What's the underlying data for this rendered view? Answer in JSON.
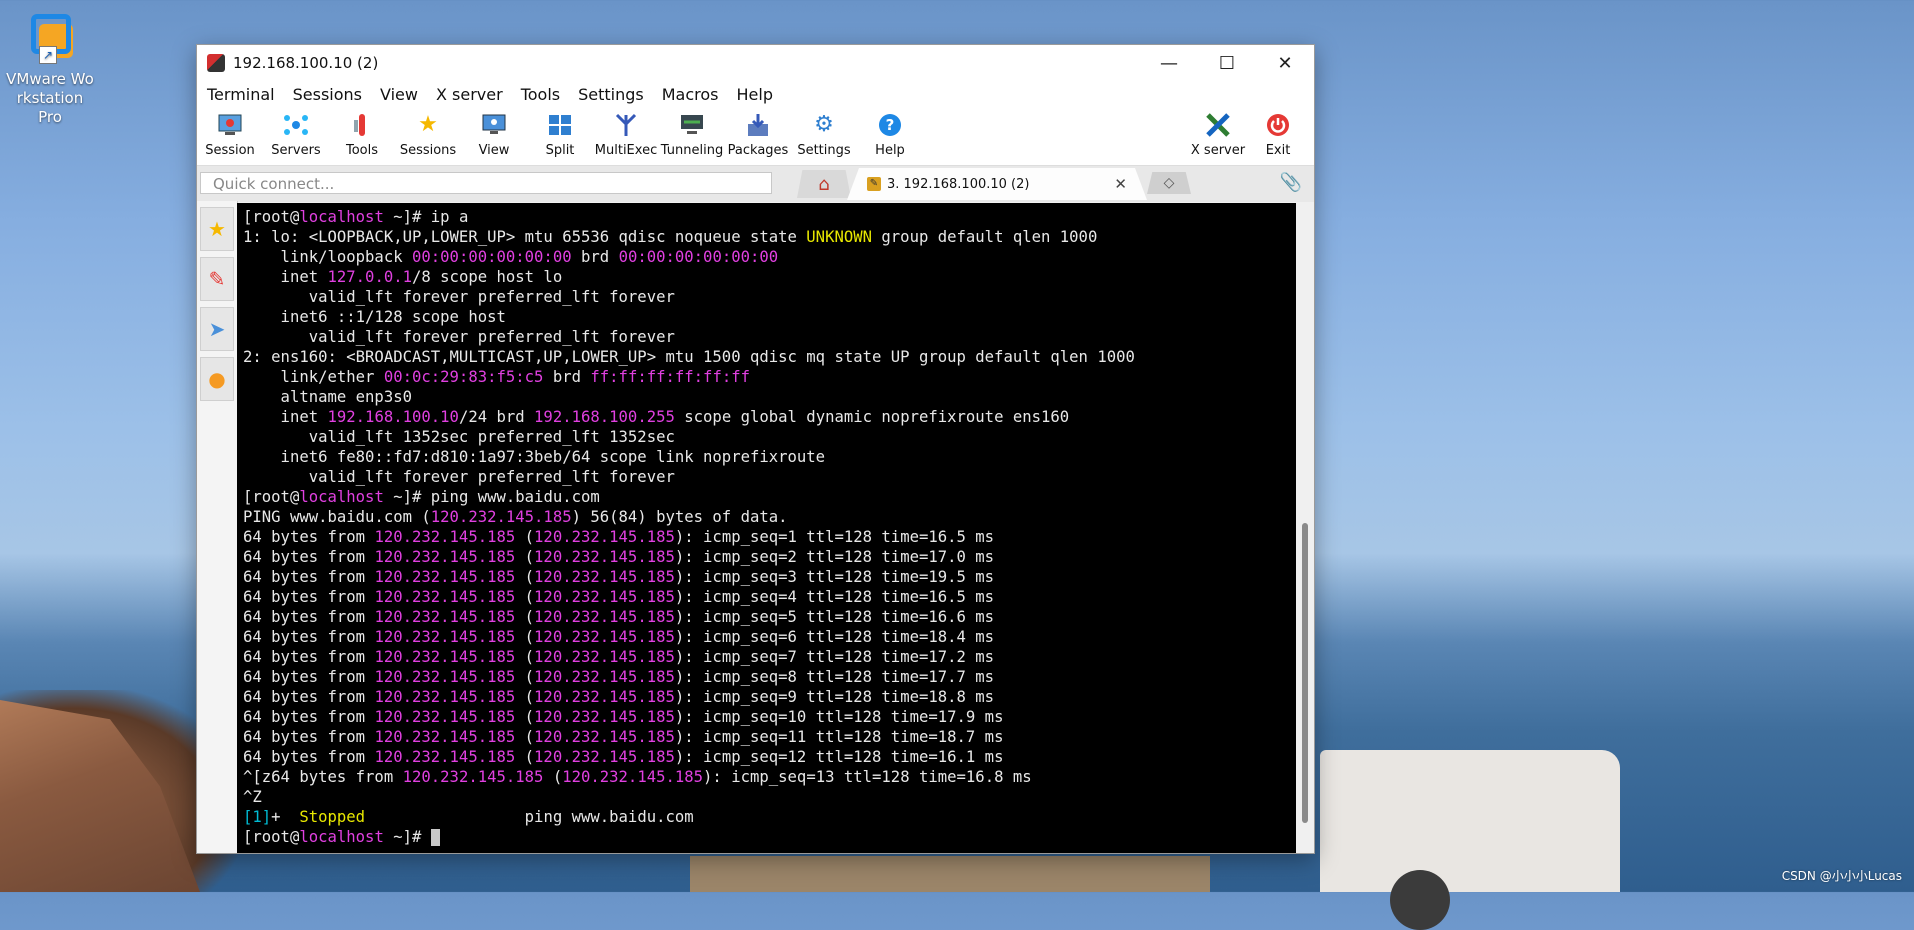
{
  "desktop": {
    "icon_label_line1": "VMware Wo",
    "icon_label_line2": "rkstation Pro",
    "watermark": "CSDN @小小小Lucas"
  },
  "window": {
    "title": "192.168.100.10 (2)",
    "controls": {
      "minimize": "—",
      "maximize": "☐",
      "close": "✕"
    }
  },
  "menu": [
    "Terminal",
    "Sessions",
    "View",
    "X server",
    "Tools",
    "Settings",
    "Macros",
    "Help"
  ],
  "toolbar": [
    {
      "label": "Session",
      "icon": "session-icon"
    },
    {
      "label": "Servers",
      "icon": "servers-icon"
    },
    {
      "label": "Tools",
      "icon": "tools-icon"
    },
    {
      "label": "Sessions",
      "icon": "star-icon"
    },
    {
      "label": "View",
      "icon": "view-icon"
    },
    {
      "label": "Split",
      "icon": "split-icon"
    },
    {
      "label": "MultiExec",
      "icon": "multiexec-icon"
    },
    {
      "label": "Tunneling",
      "icon": "tunneling-icon"
    },
    {
      "label": "Packages",
      "icon": "packages-icon"
    },
    {
      "label": "Settings",
      "icon": "gears-icon"
    },
    {
      "label": "Help",
      "icon": "help-icon"
    },
    {
      "label": "X server",
      "icon": "xserver-icon"
    },
    {
      "label": "Exit",
      "icon": "power-icon"
    }
  ],
  "quick_connect": {
    "placeholder": "Quick connect..."
  },
  "tabs": {
    "active": "3. 192.168.100.10 (2)"
  },
  "colors": {
    "terminal_bg": "#000000",
    "text": "#e8e8e8",
    "magenta": "#e040e0",
    "yellow": "#e8e800",
    "cyan": "#00bcd4",
    "accent_red": "#d32f2f"
  },
  "terminal": {
    "lines": [
      [
        {
          "t": "[root@"
        },
        {
          "t": "localhost",
          "c": "m"
        },
        {
          "t": " ~]# ip a"
        }
      ],
      [
        {
          "t": "1: lo: <LOOPBACK,UP,LOWER_UP> mtu 65536 qdisc noqueue state "
        },
        {
          "t": "UNKNOWN",
          "c": "y"
        },
        {
          "t": " group default qlen 1000"
        }
      ],
      [
        {
          "t": "    link/loopback "
        },
        {
          "t": "00:00:00:00:00:00",
          "c": "m"
        },
        {
          "t": " brd "
        },
        {
          "t": "00:00:00:00:00:00",
          "c": "m"
        }
      ],
      [
        {
          "t": "    inet "
        },
        {
          "t": "127.0.0.1",
          "c": "m"
        },
        {
          "t": "/8 scope host lo"
        }
      ],
      [
        {
          "t": "       valid_lft forever preferred_lft forever"
        }
      ],
      [
        {
          "t": "    inet6 ::1/128 scope host"
        }
      ],
      [
        {
          "t": "       valid_lft forever preferred_lft forever"
        }
      ],
      [
        {
          "t": "2: ens160: <BROADCAST,MULTICAST,UP,LOWER_UP> mtu 1500 qdisc mq state UP group default qlen 1000"
        }
      ],
      [
        {
          "t": "    link/ether "
        },
        {
          "t": "00:0c:29:83:f5:c5",
          "c": "m"
        },
        {
          "t": " brd "
        },
        {
          "t": "ff:ff:ff:ff:ff:ff",
          "c": "m"
        }
      ],
      [
        {
          "t": "    altname enp3s0"
        }
      ],
      [
        {
          "t": "    inet "
        },
        {
          "t": "192.168.100.10",
          "c": "m"
        },
        {
          "t": "/24 brd "
        },
        {
          "t": "192.168.100.255",
          "c": "m"
        },
        {
          "t": " scope global dynamic noprefixroute ens160"
        }
      ],
      [
        {
          "t": "       valid_lft 1352sec preferred_lft 1352sec"
        }
      ],
      [
        {
          "t": "    inet6 fe80::fd7:d810:1a97:3beb/64 scope link noprefixroute"
        }
      ],
      [
        {
          "t": "       valid_lft forever preferred_lft forever"
        }
      ],
      [
        {
          "t": "[root@"
        },
        {
          "t": "localhost",
          "c": "m"
        },
        {
          "t": " ~]# ping www.baidu.com"
        }
      ],
      [
        {
          "t": "PING www.baidu.com ("
        },
        {
          "t": "120.232.145.185",
          "c": "m"
        },
        {
          "t": ") 56(84) bytes of data."
        }
      ],
      [
        {
          "t": "64 bytes from "
        },
        {
          "t": "120.232.145.185",
          "c": "m"
        },
        {
          "t": " ("
        },
        {
          "t": "120.232.145.185",
          "c": "m"
        },
        {
          "t": "): icmp_seq=1 ttl=128 time=16.5 ms"
        }
      ],
      [
        {
          "t": "64 bytes from "
        },
        {
          "t": "120.232.145.185",
          "c": "m"
        },
        {
          "t": " ("
        },
        {
          "t": "120.232.145.185",
          "c": "m"
        },
        {
          "t": "): icmp_seq=2 ttl=128 time=17.0 ms"
        }
      ],
      [
        {
          "t": "64 bytes from "
        },
        {
          "t": "120.232.145.185",
          "c": "m"
        },
        {
          "t": " ("
        },
        {
          "t": "120.232.145.185",
          "c": "m"
        },
        {
          "t": "): icmp_seq=3 ttl=128 time=19.5 ms"
        }
      ],
      [
        {
          "t": "64 bytes from "
        },
        {
          "t": "120.232.145.185",
          "c": "m"
        },
        {
          "t": " ("
        },
        {
          "t": "120.232.145.185",
          "c": "m"
        },
        {
          "t": "): icmp_seq=4 ttl=128 time=16.5 ms"
        }
      ],
      [
        {
          "t": "64 bytes from "
        },
        {
          "t": "120.232.145.185",
          "c": "m"
        },
        {
          "t": " ("
        },
        {
          "t": "120.232.145.185",
          "c": "m"
        },
        {
          "t": "): icmp_seq=5 ttl=128 time=16.6 ms"
        }
      ],
      [
        {
          "t": "64 bytes from "
        },
        {
          "t": "120.232.145.185",
          "c": "m"
        },
        {
          "t": " ("
        },
        {
          "t": "120.232.145.185",
          "c": "m"
        },
        {
          "t": "): icmp_seq=6 ttl=128 time=18.4 ms"
        }
      ],
      [
        {
          "t": "64 bytes from "
        },
        {
          "t": "120.232.145.185",
          "c": "m"
        },
        {
          "t": " ("
        },
        {
          "t": "120.232.145.185",
          "c": "m"
        },
        {
          "t": "): icmp_seq=7 ttl=128 time=17.2 ms"
        }
      ],
      [
        {
          "t": "64 bytes from "
        },
        {
          "t": "120.232.145.185",
          "c": "m"
        },
        {
          "t": " ("
        },
        {
          "t": "120.232.145.185",
          "c": "m"
        },
        {
          "t": "): icmp_seq=8 ttl=128 time=17.7 ms"
        }
      ],
      [
        {
          "t": "64 bytes from "
        },
        {
          "t": "120.232.145.185",
          "c": "m"
        },
        {
          "t": " ("
        },
        {
          "t": "120.232.145.185",
          "c": "m"
        },
        {
          "t": "): icmp_seq=9 ttl=128 time=18.8 ms"
        }
      ],
      [
        {
          "t": "64 bytes from "
        },
        {
          "t": "120.232.145.185",
          "c": "m"
        },
        {
          "t": " ("
        },
        {
          "t": "120.232.145.185",
          "c": "m"
        },
        {
          "t": "): icmp_seq=10 ttl=128 time=17.9 ms"
        }
      ],
      [
        {
          "t": "64 bytes from "
        },
        {
          "t": "120.232.145.185",
          "c": "m"
        },
        {
          "t": " ("
        },
        {
          "t": "120.232.145.185",
          "c": "m"
        },
        {
          "t": "): icmp_seq=11 ttl=128 time=18.7 ms"
        }
      ],
      [
        {
          "t": "64 bytes from "
        },
        {
          "t": "120.232.145.185",
          "c": "m"
        },
        {
          "t": " ("
        },
        {
          "t": "120.232.145.185",
          "c": "m"
        },
        {
          "t": "): icmp_seq=12 ttl=128 time=16.1 ms"
        }
      ],
      [
        {
          "t": "^[z64 bytes from "
        },
        {
          "t": "120.232.145.185",
          "c": "m"
        },
        {
          "t": " ("
        },
        {
          "t": "120.232.145.185",
          "c": "m"
        },
        {
          "t": "): icmp_seq=13 ttl=128 time=16.8 ms"
        }
      ],
      [
        {
          "t": "^Z"
        }
      ],
      [
        {
          "t": "[1]",
          "c": "c"
        },
        {
          "t": "+  "
        },
        {
          "t": "Stopped",
          "c": "y"
        },
        {
          "t": "                 ping www.baidu.com"
        }
      ],
      [
        {
          "t": "[root@"
        },
        {
          "t": "localhost",
          "c": "m"
        },
        {
          "t": " ~]# "
        },
        {
          "cursor": true
        }
      ]
    ]
  }
}
